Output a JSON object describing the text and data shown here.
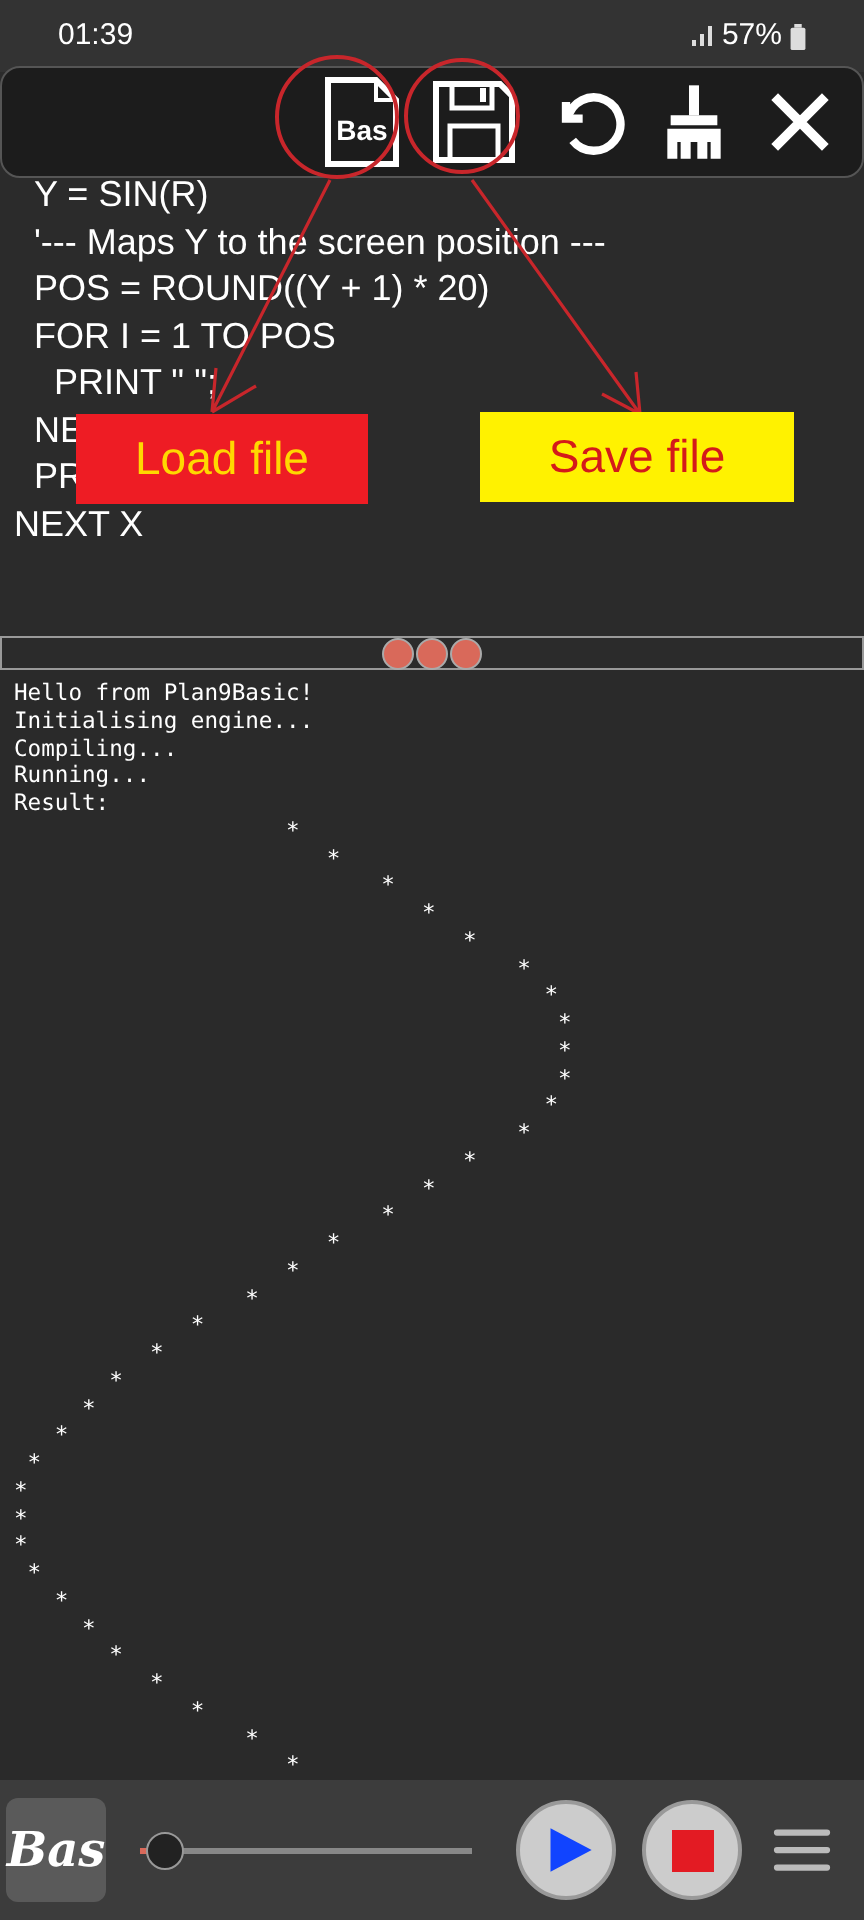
{
  "status_bar": {
    "time": "01:39",
    "battery": "57%"
  },
  "editor": {
    "lines": [
      {
        "text": "Y = SIN(R)",
        "indented": true
      },
      {
        "text": "'--- Maps Y to the screen position ---",
        "indented": true
      },
      {
        "text": "POS = ROUND((Y + 1) * 20)",
        "indented": true
      },
      {
        "text": "FOR I = 1 TO POS",
        "indented": true
      },
      {
        "text": "  PRINT \" \";",
        "indented": true
      },
      {
        "text": "NE",
        "indented": true
      },
      {
        "text": "PR",
        "indented": true
      },
      {
        "text": "NEXT X",
        "indented": false
      }
    ]
  },
  "toolbar": {
    "load_label": "Bas"
  },
  "annotations": [
    {
      "text": "Load file",
      "color": "#ee1c24"
    },
    {
      "text": "Save file",
      "color": "#fff200"
    }
  ],
  "output": {
    "lines": [
      "Hello from Plan9Basic!",
      "Initialising engine...",
      "Compiling...",
      "Running...",
      "Result:",
      "                    *",
      "                       *",
      "                           *",
      "                              *",
      "                                 *",
      "                                     *",
      "                                       *",
      "                                        *",
      "                                        *",
      "                                        *",
      "                                       *",
      "                                     *",
      "                                 *",
      "                              *",
      "                           *",
      "                       *",
      "                    *",
      "                 *",
      "             *",
      "          *",
      "       *",
      "     *",
      "   *",
      " *",
      "*",
      "*",
      "*",
      " *",
      "   *",
      "     *",
      "       *",
      "          *",
      "             *",
      "                 *",
      "                    *"
    ]
  },
  "bottom_bar": {
    "logo": "Bas",
    "slider": {
      "level": 0.03
    }
  }
}
